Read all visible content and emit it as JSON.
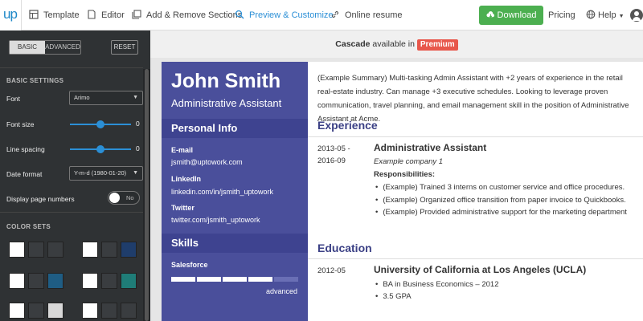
{
  "nav": {
    "logo": "up",
    "items": [
      {
        "label": "Template"
      },
      {
        "label": "Editor"
      },
      {
        "label": "Add & Remove Sections"
      },
      {
        "label": "Preview & Customize"
      },
      {
        "label": "Online resume"
      }
    ],
    "download": "Download",
    "pricing": "Pricing",
    "help": "Help"
  },
  "sidebar": {
    "tabs": [
      "BASIC",
      "ADVANCED"
    ],
    "reset": "RESET",
    "basic_settings": "BASIC SETTINGS",
    "font_label": "Font",
    "font_value": "Arimo",
    "font_size_label": "Font size",
    "font_size_value": "0",
    "font_size_level": 0.5,
    "line_spacing_label": "Line spacing",
    "line_spacing_value": "0",
    "line_spacing_level": 0.5,
    "date_format_label": "Date format",
    "date_format_value": "Y-m-d (1980-01-20)",
    "page_numbers_label": "Display page numbers",
    "page_numbers_value": "No",
    "color_sets": "COLOR SETS",
    "color_set_colors": [
      [
        "#ffffff",
        "#3a3d40",
        "#3a3d40"
      ],
      [
        "#ffffff",
        "#3a3d40",
        "#1f3d6b"
      ],
      [
        "#ffffff",
        "#3a3d40",
        "#1f5d84"
      ],
      [
        "#ffffff",
        "#3a3d40",
        "#1f7d78"
      ],
      [
        "#ffffff",
        "#3a3d40",
        "#d8d8d8"
      ],
      [
        "#ffffff",
        "#3a3d40",
        "#3a3d40"
      ]
    ]
  },
  "premium": {
    "template": "Cascade",
    "text": "available in",
    "badge": "Premium"
  },
  "resume": {
    "name": "John Smith",
    "title": "Administrative Assistant",
    "personal_info": "Personal Info",
    "email_label": "E-mail",
    "email": "jsmith@uptowork.com",
    "linkedin_label": "LinkedIn",
    "linkedin": "linkedin.com/in/jsmith_uptowork",
    "twitter_label": "Twitter",
    "twitter": "twitter.com/jsmith_uptowork",
    "skills": "Skills",
    "skill_name": "Salesforce",
    "skill_level": "advanced",
    "skill_segments": 5,
    "skill_filled": 4,
    "summary": "(Example Summary) Multi-tasking Admin Assistant with +2 years of experience in the retail real-estate industry. Can manage +3 executive schedules. Looking to leverage proven communication, travel planning, and email management skill in the position of Administrative Assistant at Acme.",
    "experience": "Experience",
    "exp_date_1": "2013-05 -",
    "exp_date_2": "2016-09",
    "exp_title": "Administrative Assistant",
    "exp_company": "Example company 1",
    "resp_label": "Responsibilities:",
    "resp": [
      "(Example) Trained 3 interns on customer service and office procedures.",
      "(Example) Organized office transition from paper invoice to Quickbooks.",
      "(Example) Provided administrative support for the marketing department"
    ],
    "education": "Education",
    "edu_date": "2012-05",
    "edu_school": "University of California at Los Angeles (UCLA)",
    "edu_items": [
      "BA in Business Economics – 2012",
      "3.5 GPA"
    ]
  },
  "colors": {
    "accent": "#2b8fd6",
    "download": "#4caf50",
    "resume_left": "#4a4f9b",
    "premium_badge": "#e8574b"
  }
}
